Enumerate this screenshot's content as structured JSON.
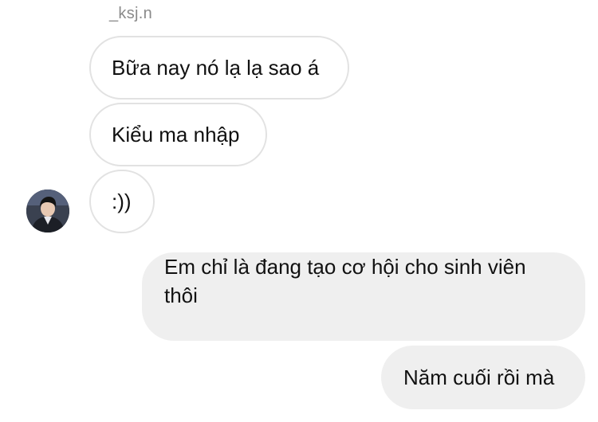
{
  "conversation": {
    "sender_name": "_ksj.n",
    "received": [
      {
        "text": "Bữa nay nó lạ lạ sao á"
      },
      {
        "text": "Kiểu ma nhập"
      },
      {
        "text": ":))"
      }
    ],
    "sent": [
      {
        "text": "Em chỉ là đang tạo cơ hội cho sinh viên thôi"
      },
      {
        "text": "Năm cuối rồi mà"
      }
    ]
  },
  "avatar": {
    "icon": "profile-photo"
  },
  "colors": {
    "received_bubble_bg": "#ffffff",
    "received_bubble_border": "#e2e2e2",
    "sent_bubble_bg": "#efefef",
    "sender_name": "#8a8a8a"
  }
}
